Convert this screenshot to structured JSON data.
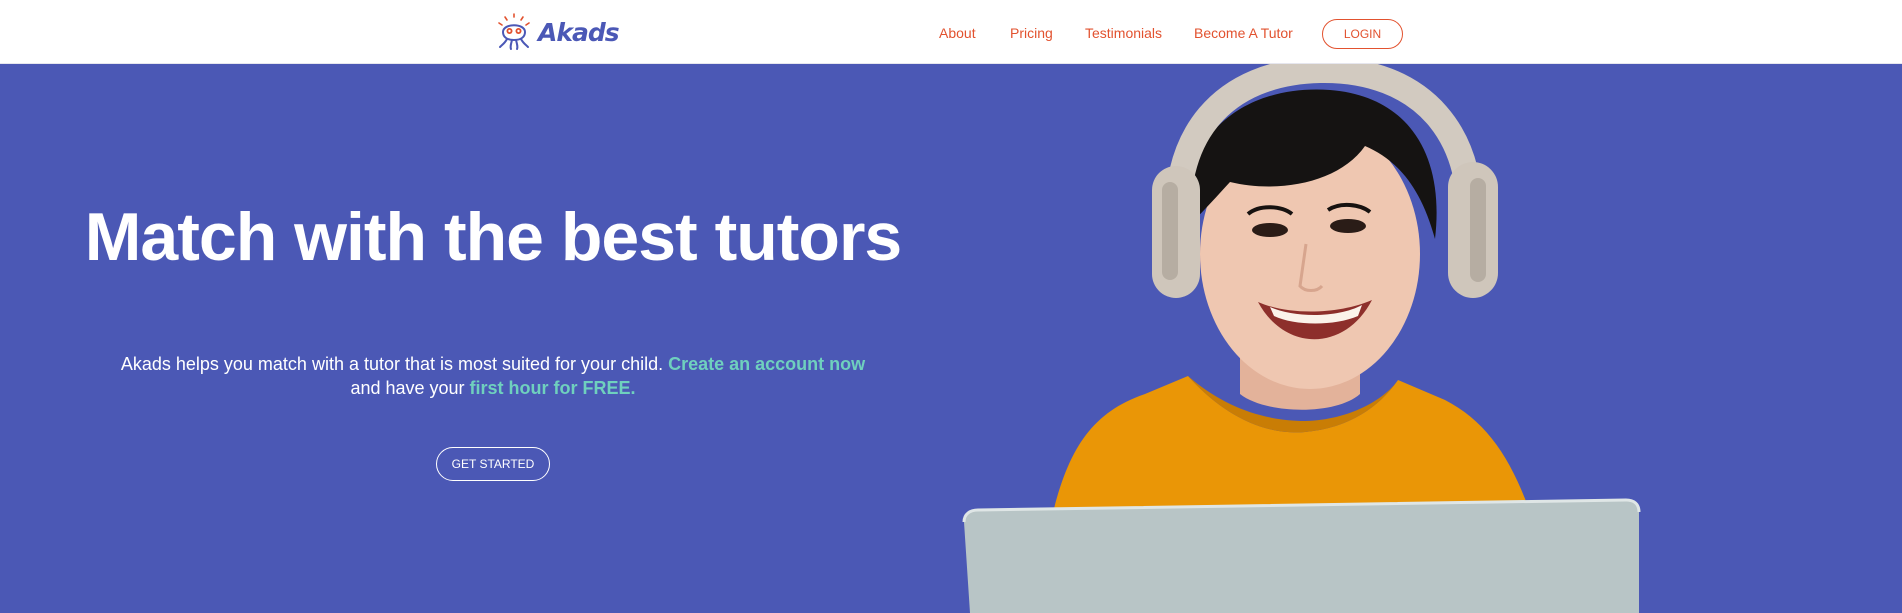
{
  "brand": {
    "name": "Akads",
    "logo_color": "#4b58b6",
    "mark_accent": "#e2522f"
  },
  "nav": {
    "links": [
      {
        "label": "About"
      },
      {
        "label": "Pricing"
      },
      {
        "label": "Testimonials"
      },
      {
        "label": "Become A Tutor"
      }
    ],
    "login_label": "LOGIN",
    "link_color": "#e2522f"
  },
  "hero": {
    "background": "#4b58b5",
    "headline": "Match with the best tutors",
    "subtext": {
      "part1": "Akads helps you match with a tutor that is most suited for your child. ",
      "link1": "Create an account now",
      "part2": " and have your ",
      "link2": "first hour for FREE.",
      "accent_color": "#6fd0be"
    },
    "cta_label": "GET STARTED",
    "image": {
      "subject": "smiling boy wearing headphones and an orange t-shirt, using a laptop"
    }
  }
}
